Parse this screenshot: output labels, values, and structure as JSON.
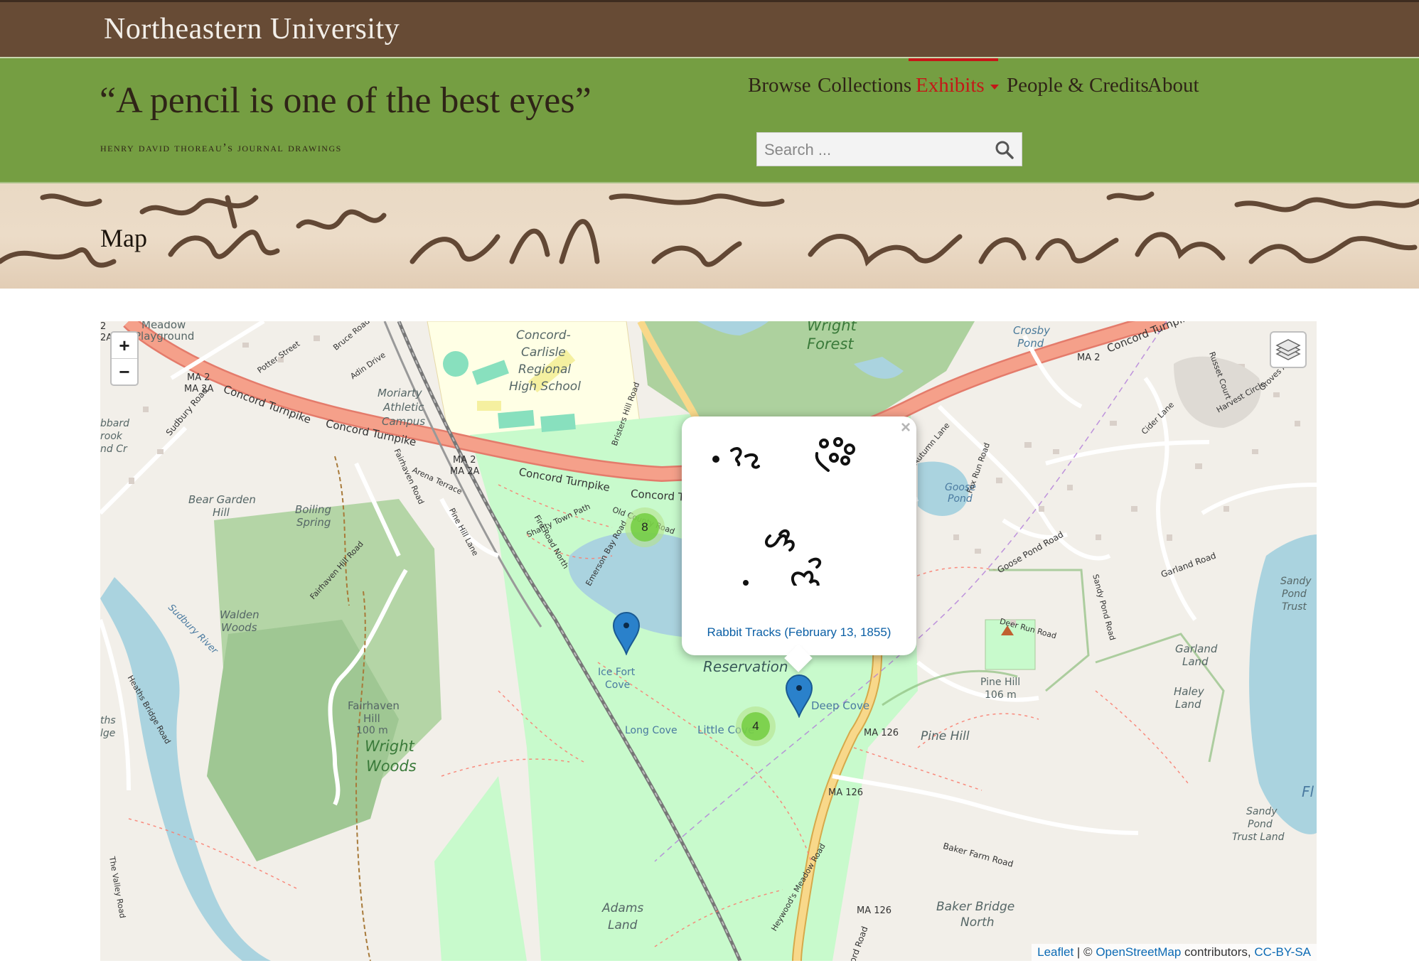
{
  "header": {
    "university": "Northeastern University",
    "site_title": "“A pencil is one of the best eyes”",
    "site_subtitle": "Henry David Thoreau’s Journal Drawings"
  },
  "nav": {
    "items": [
      {
        "label": "Browse"
      },
      {
        "label": "Collections"
      },
      {
        "label": "Exhibits"
      },
      {
        "label": "People & Credits"
      },
      {
        "label": "About"
      }
    ],
    "active": "Exhibits"
  },
  "search": {
    "placeholder": "Search ..."
  },
  "banner": {
    "page_title": "Map"
  },
  "map": {
    "zoom_in": "+",
    "zoom_out": "−",
    "popup": {
      "close": "×",
      "caption": "Rabbit Tracks (February 13, 1855)"
    },
    "clusters": [
      {
        "count": "8"
      },
      {
        "count": "4"
      }
    ],
    "labels": {
      "meadow": "Meadow",
      "playground": "Playground",
      "concord_carlisle": "Concord-",
      "carlisle": "Carlisle",
      "regional": "Regional",
      "high_school": "High School",
      "moriarty": "Moriarty",
      "athletic": "Athletic",
      "campus": "Campus",
      "wright": "Wright",
      "forest": "Forest",
      "crosby": "Crosby",
      "pond": "Pond",
      "bear_garden": "Bear Garden",
      "hill": "Hill",
      "boiling": "Boiling",
      "spring": "Spring",
      "walden": "Walden",
      "woods": "Woods",
      "fairhaven": "Fairhaven",
      "fairhaven_hill": "Hill",
      "fairhaven_elev": "100 m",
      "wright_woods_1": "Wright",
      "wright_woods_2": "Woods",
      "adams": "Adams",
      "land": "Land",
      "reservation": "Reservation",
      "deep_cove": "Deep Cove",
      "little_cove": "Little Cove",
      "long_cove": "Long Cove",
      "ice_fort": "Ice Fort",
      "cove": "Cove",
      "pine_hill": "Pine Hill",
      "pine_hill_2": "Pine Hill",
      "pine_hill_elev": "106 m",
      "goose": "Goose",
      "goose_pond": "Pond",
      "sandy_pond_trust_1": "Sandy",
      "sandy_pond_trust_2": "Pond",
      "sandy_pond_trust_3": "Trust",
      "garland": "Garland",
      "garland_land": "Land",
      "haley": "Haley",
      "haley_land": "Land",
      "sandy_pond_trust_land_1": "Sandy",
      "sandy_pond_trust_land_2": "Pond",
      "sandy_pond_trust_land_3": "Trust Land",
      "baker_bridge": "Baker Bridge",
      "north": "North",
      "concord_turnpike_1": "Concord Turnpike",
      "concord_turnpike_2": "Concord Turnpike",
      "concord_turnpike_3": "Concord Turnpike",
      "concord_turnpike_4": "Concord T",
      "concord_turnpike_5": "Concord Turnpike",
      "ma2_1": "MA 2",
      "ma2a_1": "MA 2A",
      "ma2_2": "MA 2",
      "ma2a_2": "MA 2A",
      "ma2_3": "MA 2",
      "ma126_1": "MA 126",
      "ma126_2": "MA 126",
      "ma126_3": "MA 126",
      "sudbury_river": "Sudbury River",
      "sudbury_road": "Sudbury Road",
      "goose_pond_road": "Goose Pond Road",
      "garland_road": "Garland Road",
      "baker_farm_road": "Baker Farm Road",
      "heaths_bridge_road": "Heaths Bridge Road",
      "fairhaven_hill_road": "Fairhaven Hill Road",
      "old_county_road": "Old County Road",
      "shanty_town_path": "Shanty Town Path",
      "pine_hill_lane": "Pine Hill Lane",
      "arena_terrace": "Arena Terrace",
      "fairhaven_road": "Fairhaven Road",
      "potter_street": "Potter Street",
      "adin_drive": "Adin Drive",
      "bruce_road": "Bruce Road",
      "haywood_meadow_road": "Heywood's Meadow Road",
      "sandy_pond_road": "Sandy Pond Road",
      "deer_run_road": "Deer Run Road",
      "fox_run_road": "Fox Run Road",
      "autumn_lane": "Autumn Lane",
      "cider_lane": "Cider Lane",
      "bristers_hill_road": "Bristers Hill Road",
      "fire_road_north": "Fire Road North",
      "emerson_bay_road": "Emerson Bay Road",
      "the_valley_road": "The Valley Road",
      "russet_court": "Russet Court",
      "harvest_circle": "Harvest Circle",
      "groves_avenue": "Groves Avenue",
      "flint": "Fl",
      "ourd_road": "ord Road",
      "bbard": "bbard",
      "rook": "rook",
      "nd_cr": "nd Cr",
      "map2": "2",
      "map2a": "2A",
      "ths": "ths",
      "lge": "lge"
    },
    "attribution": {
      "leaflet": "Leaflet",
      "sep": " | © ",
      "osm": "OpenStreetMap",
      "contrib": " contributors, ",
      "license": "CC-BY-SA"
    },
    "colors": {
      "water": "#aad3df",
      "park": "#c8facc",
      "wood": "#add19e",
      "motorway": "#f5a08a",
      "secondary": "#f8d88a",
      "background": "#f2efe9",
      "marker": "#2a81cb"
    }
  }
}
